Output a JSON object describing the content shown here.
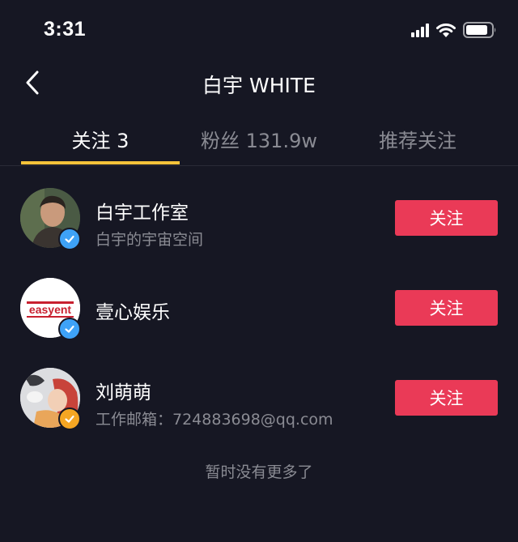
{
  "status_bar": {
    "time": "3:31"
  },
  "header": {
    "title": "白宇 WHITE"
  },
  "tabs": [
    {
      "label": "关注 3",
      "active": true
    },
    {
      "label": "粉丝 131.9w",
      "active": false
    },
    {
      "label": "推荐关注",
      "active": false
    }
  ],
  "users": [
    {
      "name": "白宇工作室",
      "subtitle": "白宇的宇宙空间",
      "button": "关注",
      "verified": "blue"
    },
    {
      "name": "壹心娱乐",
      "subtitle": "",
      "button": "关注",
      "verified": "blue",
      "avatar_logo": "easyent"
    },
    {
      "name": "刘萌萌",
      "subtitle": "工作邮箱：724883698@qq.com",
      "button": "关注",
      "verified": "gold"
    }
  ],
  "footer": {
    "text": "暂时没有更多了"
  },
  "colors": {
    "background": "#161723",
    "accent_tab": "#f5c33a",
    "follow_button": "#ea3a57",
    "verified_blue": "#3ea2f7",
    "verified_gold": "#f5a623"
  }
}
